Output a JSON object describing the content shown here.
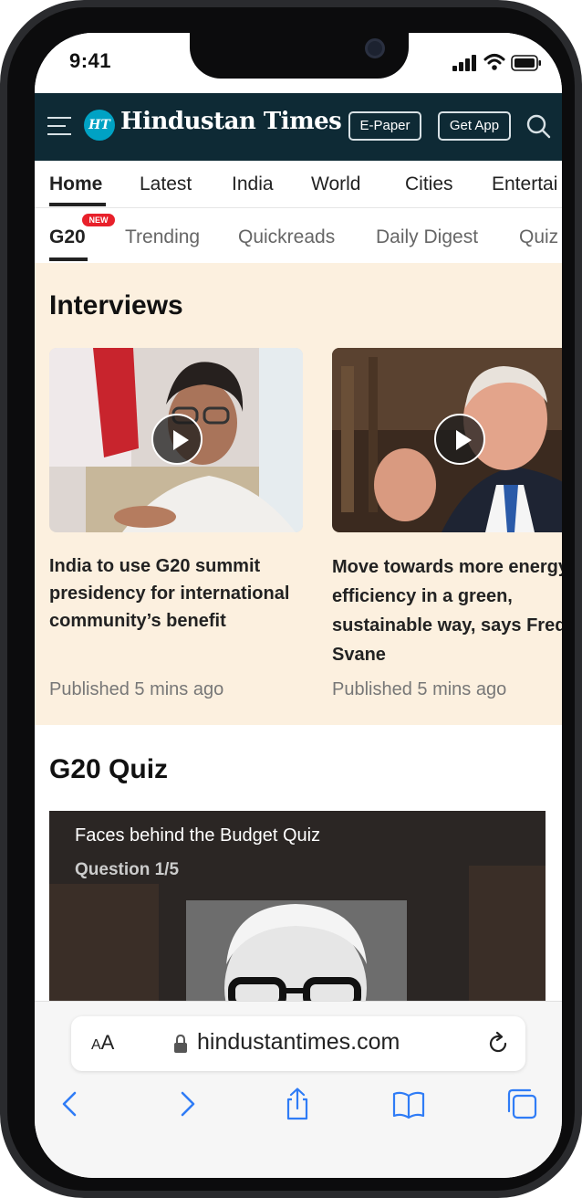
{
  "status_bar": {
    "time": "9:41"
  },
  "header": {
    "logo_badge": "HT",
    "logo_text": "Hindustan Times",
    "epaper_label": "E-Paper",
    "getapp_label": "Get App"
  },
  "nav_primary": [
    {
      "label": "Home",
      "active": true
    },
    {
      "label": "Latest"
    },
    {
      "label": "India"
    },
    {
      "label": "World"
    },
    {
      "label": "Cities"
    },
    {
      "label": "Entertai"
    }
  ],
  "nav_secondary": [
    {
      "label": "G20",
      "active": true,
      "badge": "NEW"
    },
    {
      "label": "Trending"
    },
    {
      "label": "Quickreads"
    },
    {
      "label": "Daily Digest"
    },
    {
      "label": "Quiz"
    }
  ],
  "interviews": {
    "title": "Interviews",
    "cards": [
      {
        "headline": "India to use G20 summit presidency for international community’s benefit",
        "published": "Published 5 mins ago"
      },
      {
        "headline": "Move towards more energy efficiency in a green, sustainable way, says Freddy Svane",
        "published": "Published 5 mins ago"
      }
    ]
  },
  "quiz": {
    "title": "G20 Quiz",
    "card_title": "Faces behind the Budget Quiz",
    "question": "Question 1/5"
  },
  "safari": {
    "aa_small": "A",
    "aa_large": "A",
    "url": "hindustantimes.com"
  },
  "colors": {
    "header_bg": "#0e2a35",
    "brand_accent": "#00a2c4",
    "interviews_bg": "#fcf0df",
    "badge_red": "#e8202a",
    "ios_blue": "#2f7cf6"
  }
}
